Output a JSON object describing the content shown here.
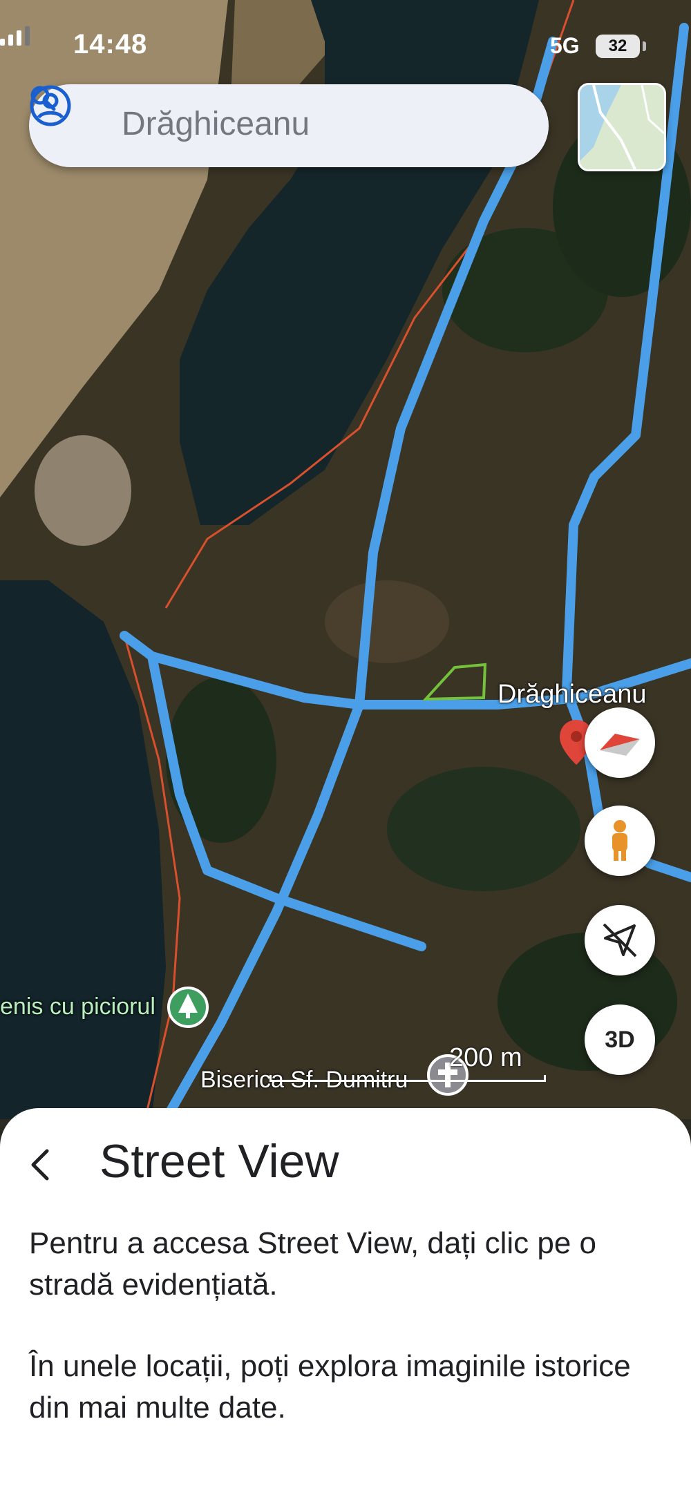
{
  "status_bar": {
    "time": "14:48",
    "network": "5G",
    "battery": "32"
  },
  "search": {
    "text": "Drăghiceanu"
  },
  "map": {
    "place_label": "Drăghiceanu",
    "poi_left_label": "enis cu piciorul",
    "poi_bottom_label": "Biserica Sf. Dumitru",
    "scale_text": "200 m",
    "colors": {
      "streetview_blue": "#4a9fe8",
      "boundary": "#d9502e",
      "water": "#15262a",
      "pin_red": "#e0453a",
      "poi_green": "#3e9e5f"
    }
  },
  "controls": {
    "compass_icon": "compass-icon",
    "pegman_icon": "pegman-icon",
    "location_off_icon": "location-off-icon",
    "three_d_label": "3D"
  },
  "sheet": {
    "title": "Street View",
    "paragraph_1": "Pentru a accesa Street View, dați clic pe o stradă evidențiată.",
    "paragraph_2": "În unele locații, poți explora imaginile istorice din mai multe date."
  }
}
